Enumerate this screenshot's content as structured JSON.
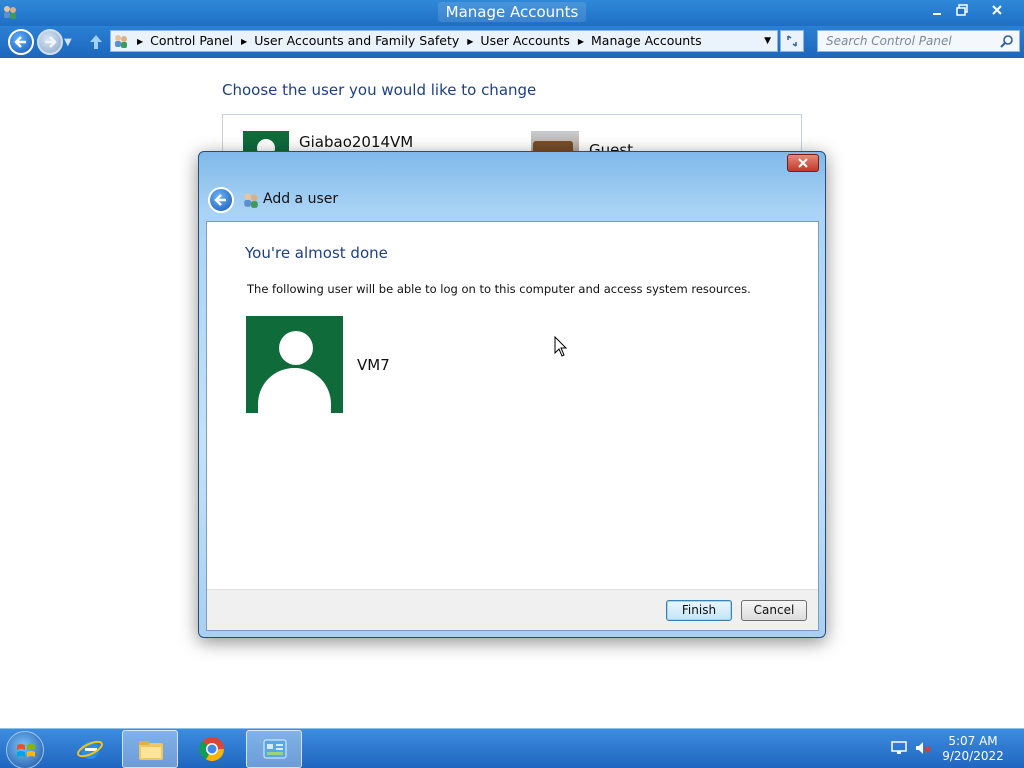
{
  "window": {
    "title": "Manage Accounts"
  },
  "navbar": {
    "breadcrumbs": [
      "Control Panel",
      "User Accounts and Family Safety",
      "User Accounts",
      "Manage Accounts"
    ],
    "search_placeholder": "Search Control Panel"
  },
  "background": {
    "heading": "Choose the user you would like to change",
    "accounts": [
      {
        "name": "Giabao2014VM"
      },
      {
        "name": "Guest"
      }
    ]
  },
  "dialog": {
    "title": "Add a user",
    "heading": "You're almost done",
    "info": "The following user will be able to log on to this computer and access system resources.",
    "user_name": "VM7",
    "finish_label": "Finish",
    "cancel_label": "Cancel"
  },
  "taskbar": {
    "items": [
      "internet-explorer",
      "file-explorer",
      "chrome",
      "control-panel"
    ],
    "time": "5:07 AM",
    "date": "9/20/2022"
  },
  "colors": {
    "accent": "#1f6fc4",
    "heading_blue": "#1e3f82",
    "avatar_green": "#0f6b3a"
  }
}
